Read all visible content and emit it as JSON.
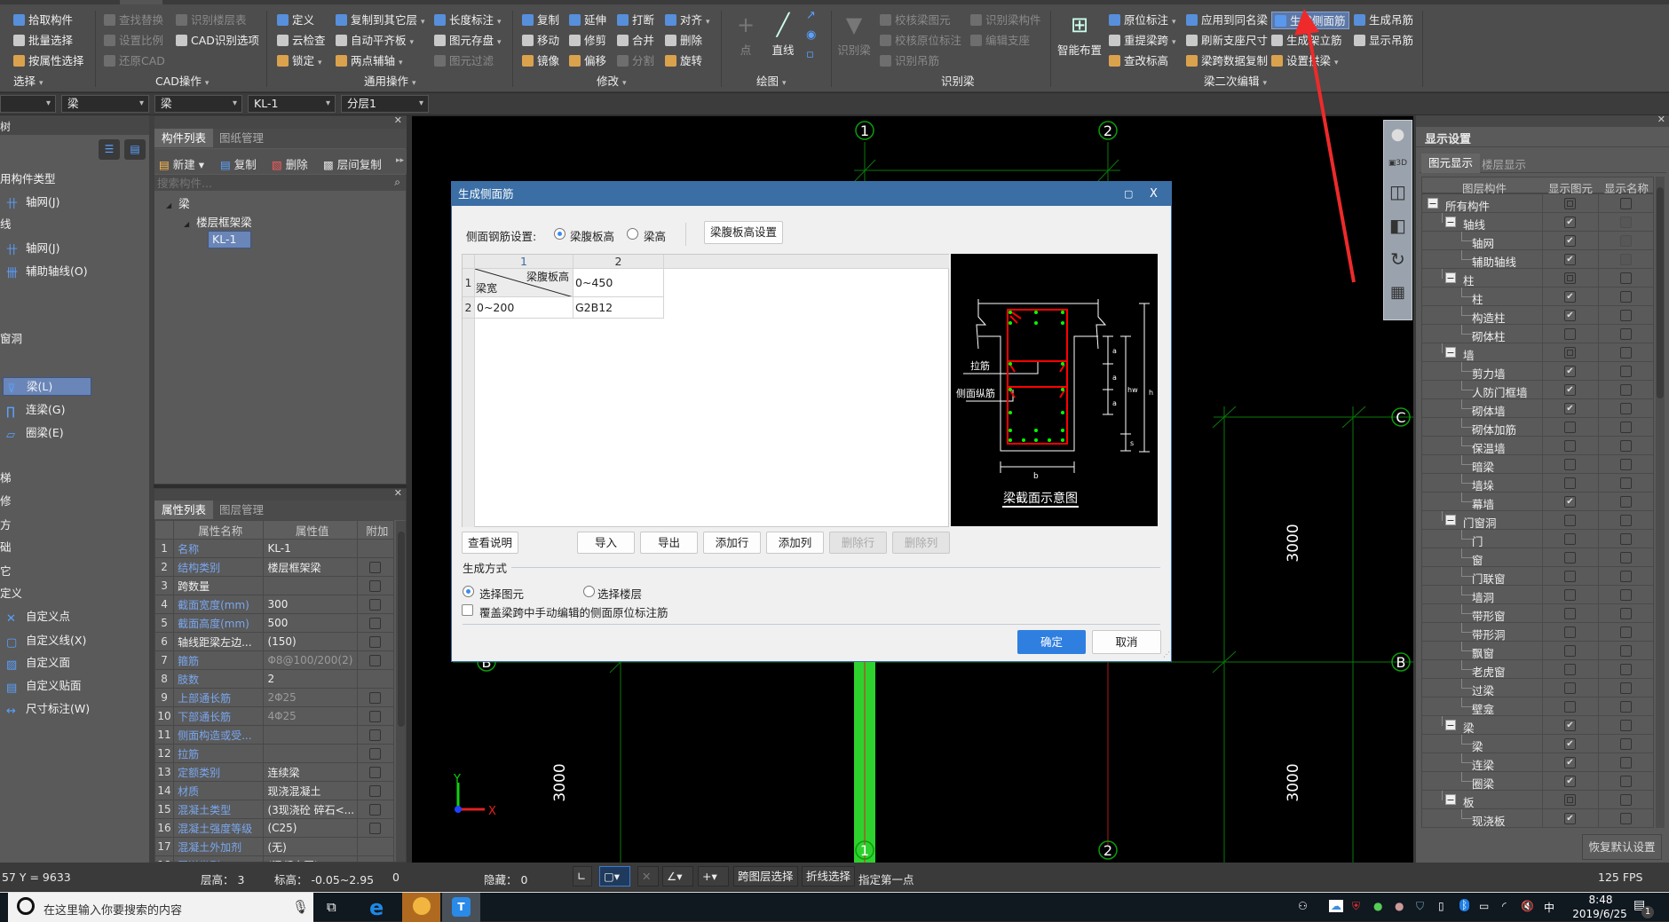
{
  "ribbon": {
    "groups": {
      "select": "选择",
      "cad": "CAD操作",
      "general": "通用操作",
      "modify": "修改",
      "draw": "绘图",
      "recognize": "识别梁",
      "beam_edit": "梁二次编辑"
    },
    "select": [
      "拾取构件",
      "批量选择",
      "按属性选择"
    ],
    "cad": {
      "col1": [
        "查找替换",
        "设置比例",
        "还原CAD"
      ],
      "col2": [
        "识别楼层表",
        "CAD识别选项"
      ]
    },
    "general": {
      "col1": [
        "定义",
        "云检查",
        "锁定"
      ],
      "col2": [
        "复制到其它层",
        "自动平齐板",
        "两点辅轴"
      ],
      "col3": [
        "长度标注",
        "图元存盘",
        "图元过滤"
      ]
    },
    "modify": {
      "col1": [
        "复制",
        "移动",
        "镜像"
      ],
      "col2": [
        "延伸",
        "修剪",
        "偏移"
      ],
      "col3": [
        "打断",
        "合并",
        "分割"
      ],
      "col4": [
        "对齐",
        "删除",
        "旋转"
      ]
    },
    "draw": {
      "point": "点",
      "line": "直线"
    },
    "recognize": {
      "big": "识别梁",
      "col1": [
        "校核梁图元",
        "校核原位标注",
        "识别吊筋"
      ],
      "col2": [
        "识别梁构件",
        "编辑支座"
      ]
    },
    "beam_edit": {
      "big": "智能布置",
      "col1": [
        "原位标注",
        "重提梁跨",
        "查改标高"
      ],
      "col2": [
        "应用到同名梁",
        "刷新支座尺寸",
        "梁跨数据复制"
      ],
      "col3": [
        "生成侧面筋",
        "生成架立筋",
        "设置拱梁"
      ],
      "col4": [
        "生成吊筋",
        "显示吊筋"
      ]
    }
  },
  "selectors": [
    "",
    "梁",
    "梁",
    "KL-1",
    "分层1"
  ],
  "nav_tree": {
    "items": [
      {
        "label": "用构件类型",
        "type": "header"
      },
      {
        "label": "轴网(J)",
        "type": "item",
        "icon": "grid-icon"
      },
      {
        "label": "线",
        "type": "header"
      },
      {
        "label": "轴网(J)",
        "type": "item",
        "icon": "grid-icon"
      },
      {
        "label": "辅助轴线(O)",
        "type": "item",
        "icon": "aux-axis-icon"
      },
      {
        "label": "窗洞",
        "type": "header"
      },
      {
        "label": "梁(L)",
        "type": "item",
        "icon": "beam-icon",
        "selected": true
      },
      {
        "label": "连梁(G)",
        "type": "item",
        "icon": "coupling-beam-icon"
      },
      {
        "label": "圈梁(E)",
        "type": "item",
        "icon": "ring-beam-icon"
      },
      {
        "label": "梯",
        "type": "header"
      },
      {
        "label": "修",
        "type": "header"
      },
      {
        "label": "方",
        "type": "header"
      },
      {
        "label": "础",
        "type": "header"
      },
      {
        "label": "它",
        "type": "header"
      },
      {
        "label": "定义",
        "type": "header"
      },
      {
        "label": "自定义点",
        "type": "item",
        "icon": "custom-point-icon"
      },
      {
        "label": "自定义线(X)",
        "type": "item",
        "icon": "custom-line-icon"
      },
      {
        "label": "自定义面",
        "type": "item",
        "icon": "custom-face-icon"
      },
      {
        "label": "自定义贴面",
        "type": "item",
        "icon": "custom-facing-icon"
      },
      {
        "label": "尺寸标注(W)",
        "type": "item",
        "icon": "dimension-icon"
      }
    ],
    "title": "树"
  },
  "component_list": {
    "tabs": [
      "构件列表",
      "图纸管理"
    ],
    "toolbar": [
      "新建",
      "复制",
      "删除",
      "层间复制"
    ],
    "search_placeholder": "搜索构件...",
    "tree": [
      "梁",
      "楼层框架梁",
      "KL-1"
    ]
  },
  "properties": {
    "tabs": [
      "属性列表",
      "图层管理"
    ],
    "headers": [
      "属性名称",
      "属性值",
      "附加"
    ],
    "rows": [
      {
        "n": "1",
        "name": "名称",
        "value": "KL-1",
        "link": true,
        "cb": false
      },
      {
        "n": "2",
        "name": "结构类别",
        "value": "楼层框架梁",
        "link": true,
        "cb": true
      },
      {
        "n": "3",
        "name": "跨数量",
        "value": "",
        "link": false,
        "cb": true
      },
      {
        "n": "4",
        "name": "截面宽度(mm)",
        "value": "300",
        "link": true,
        "cb": true
      },
      {
        "n": "5",
        "name": "截面高度(mm)",
        "value": "500",
        "link": true,
        "cb": true
      },
      {
        "n": "6",
        "name": "轴线距梁左边...",
        "value": "(150)",
        "link": false,
        "cb": true
      },
      {
        "n": "7",
        "name": "箍筋",
        "value": "Φ8@100/200(2)",
        "link": true,
        "cb": true,
        "dim": true
      },
      {
        "n": "8",
        "name": "肢数",
        "value": "2",
        "link": true,
        "cb": false
      },
      {
        "n": "9",
        "name": "上部通长筋",
        "value": "2Φ25",
        "link": true,
        "cb": true,
        "dim": true
      },
      {
        "n": "10",
        "name": "下部通长筋",
        "value": "4Φ25",
        "link": true,
        "cb": true,
        "dim": true
      },
      {
        "n": "11",
        "name": "侧面构造或受...",
        "value": "",
        "link": true,
        "cb": true
      },
      {
        "n": "12",
        "name": "拉筋",
        "value": "",
        "link": true,
        "cb": true
      },
      {
        "n": "13",
        "name": "定额类别",
        "value": "连续梁",
        "link": true,
        "cb": true
      },
      {
        "n": "14",
        "name": "材质",
        "value": "现浇混凝土",
        "link": true,
        "cb": true
      },
      {
        "n": "15",
        "name": "混凝土类型",
        "value": "(3现浇砼 碎石<...",
        "link": true,
        "cb": true
      },
      {
        "n": "16",
        "name": "混凝土强度等级",
        "value": "(C25)",
        "link": true,
        "cb": true
      },
      {
        "n": "17",
        "name": "混凝土外加剂",
        "value": "(无)",
        "link": true,
        "cb": false
      },
      {
        "n": "18",
        "name": "泵送类型",
        "value": "(混凝土泵)",
        "link": true,
        "cb": false
      }
    ]
  },
  "canvas": {
    "axes_top": [
      "1",
      "2"
    ],
    "axes_bottom": [
      "1",
      "2"
    ],
    "axes_right": [
      "C",
      "B"
    ],
    "axis_left": "B",
    "dims": [
      "3000",
      "3000",
      "3000"
    ],
    "ucs": {
      "x": "X",
      "y": "Y"
    }
  },
  "dialog": {
    "title": "生成侧面筋",
    "setting_label": "侧面钢筋设置:",
    "radio_options": [
      "梁腹板高",
      "梁高"
    ],
    "radio_selected": "梁腹板高",
    "setting_button": "梁腹板高设置",
    "grid": {
      "col_headers": [
        "1",
        "2"
      ],
      "row_headers": [
        "1",
        "2"
      ],
      "corner_top": "梁腹板高",
      "corner_bottom": "梁宽",
      "cells": [
        [
          "0~450"
        ],
        [
          "0~200",
          "G2B12"
        ]
      ]
    },
    "figure": {
      "title": "梁截面示意图",
      "labels": {
        "tie": "拉筋",
        "side": "侧面纵筋",
        "a": "a",
        "hw": "hw",
        "h": "h",
        "s": "s",
        "b": "b"
      }
    },
    "buttons": [
      "查看说明",
      "导入",
      "导出",
      "添加行",
      "添加列",
      "删除行",
      "删除列"
    ],
    "gen_label": "生成方式",
    "gen_options": [
      "选择图元",
      "选择楼层"
    ],
    "gen_selected": "选择图元",
    "override_label": "覆盖梁跨中手动编辑的侧面原位标注筋",
    "override_checked": false,
    "ok": "确定",
    "cancel": "取消",
    "accent": "#2f7fe0",
    "title_color": "#3a6ea5"
  },
  "display_settings": {
    "title": "显示设置",
    "tabs": [
      "图元显示",
      "楼层显示"
    ],
    "headers": [
      "图层构件",
      "显示图元",
      "显示名称"
    ],
    "rows": [
      {
        "l": 0,
        "name": "所有构件",
        "show": "partial",
        "label": "off"
      },
      {
        "l": 1,
        "name": "轴线",
        "show": "on",
        "label": "disabled"
      },
      {
        "l": 2,
        "name": "轴网",
        "show": "on",
        "label": "disabled"
      },
      {
        "l": 2,
        "name": "辅助轴线",
        "show": "on",
        "label": "disabled"
      },
      {
        "l": 1,
        "name": "柱",
        "show": "partial",
        "label": "off"
      },
      {
        "l": 2,
        "name": "柱",
        "show": "on",
        "label": "off"
      },
      {
        "l": 2,
        "name": "构造柱",
        "show": "on",
        "label": "off"
      },
      {
        "l": 2,
        "name": "砌体柱",
        "show": "off",
        "label": "off"
      },
      {
        "l": 1,
        "name": "墙",
        "show": "partial",
        "label": "off"
      },
      {
        "l": 2,
        "name": "剪力墙",
        "show": "on",
        "label": "off"
      },
      {
        "l": 2,
        "name": "人防门框墙",
        "show": "on",
        "label": "off"
      },
      {
        "l": 2,
        "name": "砌体墙",
        "show": "on",
        "label": "off"
      },
      {
        "l": 2,
        "name": "砌体加筋",
        "show": "off",
        "label": "off"
      },
      {
        "l": 2,
        "name": "保温墙",
        "show": "off",
        "label": "off"
      },
      {
        "l": 2,
        "name": "暗梁",
        "show": "off",
        "label": "off"
      },
      {
        "l": 2,
        "name": "墙垛",
        "show": "off",
        "label": "off"
      },
      {
        "l": 2,
        "name": "幕墙",
        "show": "on",
        "label": "off"
      },
      {
        "l": 1,
        "name": "门窗洞",
        "show": "off",
        "label": "off"
      },
      {
        "l": 2,
        "name": "门",
        "show": "off",
        "label": "off"
      },
      {
        "l": 2,
        "name": "窗",
        "show": "off",
        "label": "off"
      },
      {
        "l": 2,
        "name": "门联窗",
        "show": "off",
        "label": "off"
      },
      {
        "l": 2,
        "name": "墙洞",
        "show": "off",
        "label": "off"
      },
      {
        "l": 2,
        "name": "带形窗",
        "show": "off",
        "label": "off"
      },
      {
        "l": 2,
        "name": "带形洞",
        "show": "off",
        "label": "off"
      },
      {
        "l": 2,
        "name": "飘窗",
        "show": "off",
        "label": "off"
      },
      {
        "l": 2,
        "name": "老虎窗",
        "show": "off",
        "label": "off"
      },
      {
        "l": 2,
        "name": "过梁",
        "show": "off",
        "label": "off"
      },
      {
        "l": 2,
        "name": "壁龛",
        "show": "off",
        "label": "off"
      },
      {
        "l": 1,
        "name": "梁",
        "show": "on",
        "label": "off"
      },
      {
        "l": 2,
        "name": "梁",
        "show": "on",
        "label": "off"
      },
      {
        "l": 2,
        "name": "连梁",
        "show": "on",
        "label": "off"
      },
      {
        "l": 2,
        "name": "圈梁",
        "show": "on",
        "label": "off"
      },
      {
        "l": 1,
        "name": "板",
        "show": "partial",
        "label": "off"
      },
      {
        "l": 2,
        "name": "现浇板",
        "show": "on",
        "label": "off"
      }
    ],
    "reset_button": "恢复默认设置"
  },
  "status": {
    "coords": "57 Y = 9633",
    "floor_height": "层高：  3",
    "elevation": "标高：  -0.05~2.95",
    "zero": "0",
    "hidden": "隐藏：  0",
    "cross_layer": "跨图层选择",
    "polyline": "折线选择",
    "prompt": "指定第一点",
    "fps": "125 FPS"
  },
  "taskbar": {
    "search_placeholder": "在这里输入你要搜索的内容",
    "time": "8:48",
    "date": "2019/6/25",
    "ime": "中",
    "notifications": "1"
  }
}
